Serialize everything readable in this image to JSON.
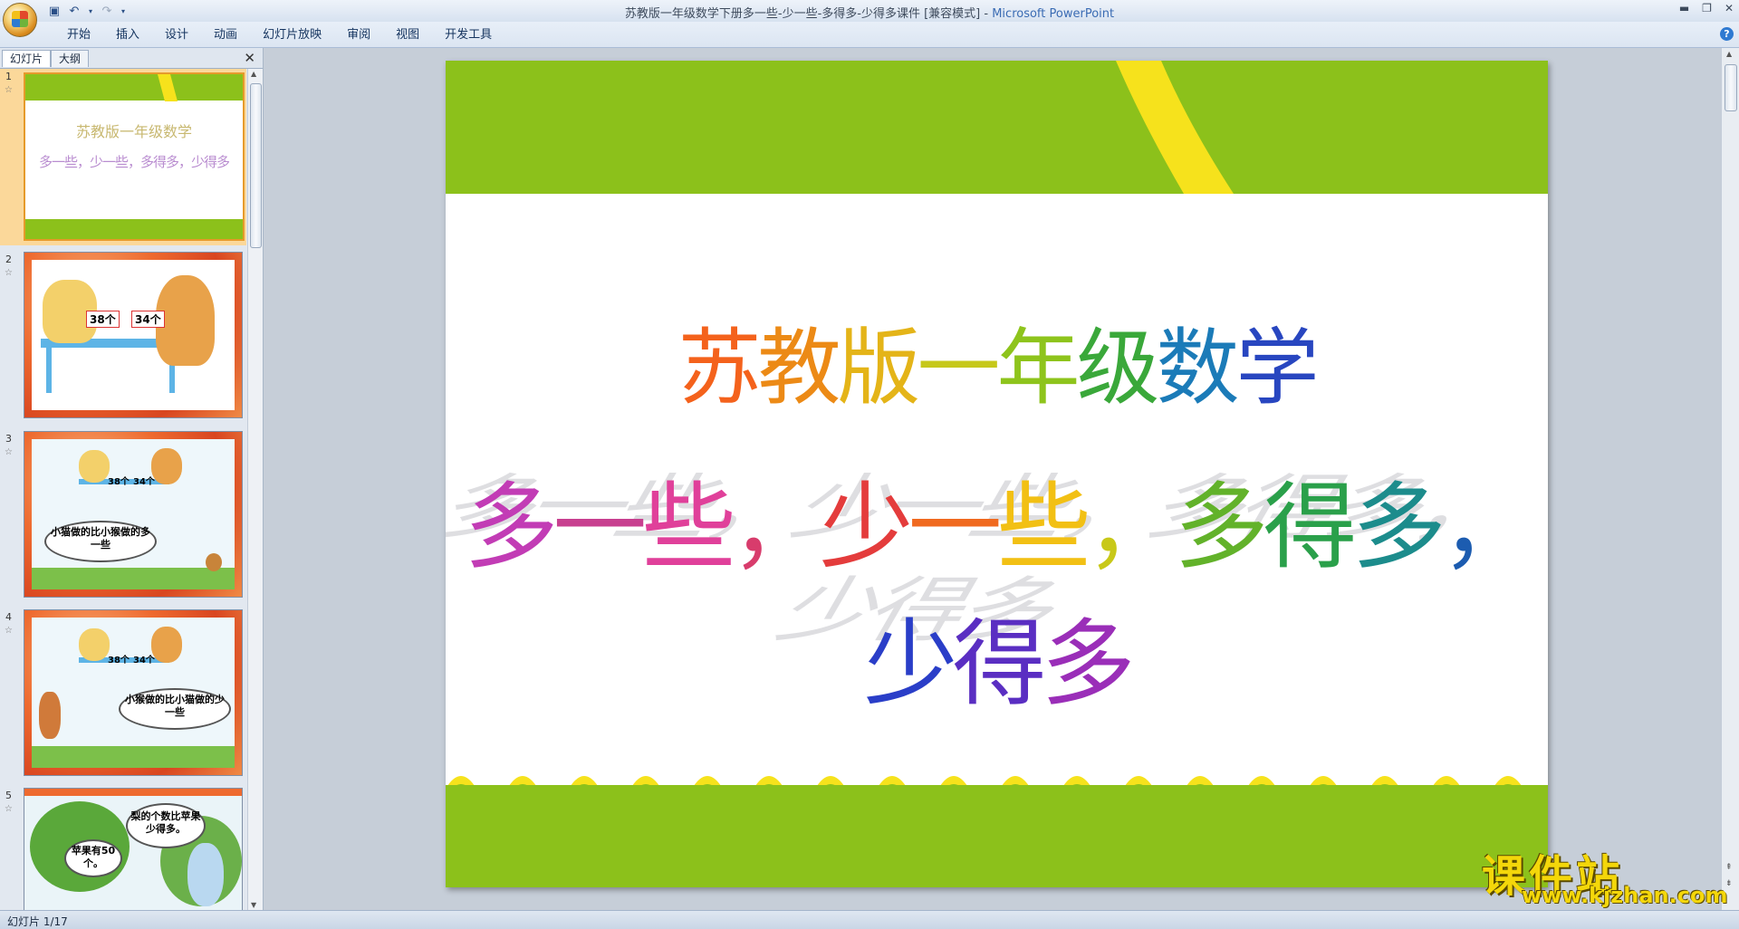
{
  "window": {
    "title_doc": "苏教版一年级数学下册多一些-少一些-多得多-少得多课件 [兼容模式]",
    "title_sep": " - ",
    "title_app": "Microsoft PowerPoint"
  },
  "ribbon": {
    "tabs": [
      "开始",
      "插入",
      "设计",
      "动画",
      "幻灯片放映",
      "审阅",
      "视图",
      "开发工具"
    ]
  },
  "left_pane": {
    "tab_slides": "幻灯片",
    "tab_outline": "大纲",
    "close": "✕",
    "thumbnails": [
      {
        "num": "1",
        "line1": "苏教版一年级数学",
        "line2": "多一些，少一些，多得多，少得多"
      },
      {
        "num": "2",
        "label_a": "38个",
        "label_b": "34个"
      },
      {
        "num": "3",
        "label_a": "38个",
        "label_b": "34个",
        "bubble": "小猫做的比小猴做的多一些"
      },
      {
        "num": "4",
        "label_a": "38个",
        "label_b": "34个",
        "bubble": "小猴做的比小猫做的少一些"
      },
      {
        "num": "5",
        "bubble_a": "梨的个数比苹果少得多。",
        "bubble_b": "苹果有50个。"
      }
    ]
  },
  "slide": {
    "title_line1": [
      "苏",
      "教",
      "版",
      "一",
      "年",
      "级",
      "数",
      "学"
    ],
    "title_line1_colors": [
      "#f4621c",
      "#ec8a16",
      "#e4b418",
      "#c6c81a",
      "#8ec41c",
      "#3aa83a",
      "#1b7bb8",
      "#2846c0"
    ],
    "title_line2": [
      "多",
      "一",
      "些",
      "，",
      "少",
      "一",
      "些",
      "，",
      "多",
      "得",
      "多",
      "，",
      "少",
      "得",
      "多"
    ],
    "title_line2_colors": [
      "#c23cb5",
      "#c84090",
      "#e0409a",
      "#d83c6c",
      "#e43c3c",
      "#f06a20",
      "#f2c014",
      "#c8c818",
      "#62b22a",
      "#2aa04a",
      "#1c8c8c",
      "#1c5cb0",
      "#2a3ec8",
      "#5a2ec2",
      "#9a2eb8"
    ]
  },
  "status": {
    "text": "幻灯片 1/17"
  },
  "watermark": {
    "big": "课件站",
    "small": "www.kjzhan.com"
  },
  "colors": {
    "slide_green": "#8cc11b",
    "slide_yellow": "#f6e21c",
    "thumb_orange": "#ee6a2f"
  }
}
